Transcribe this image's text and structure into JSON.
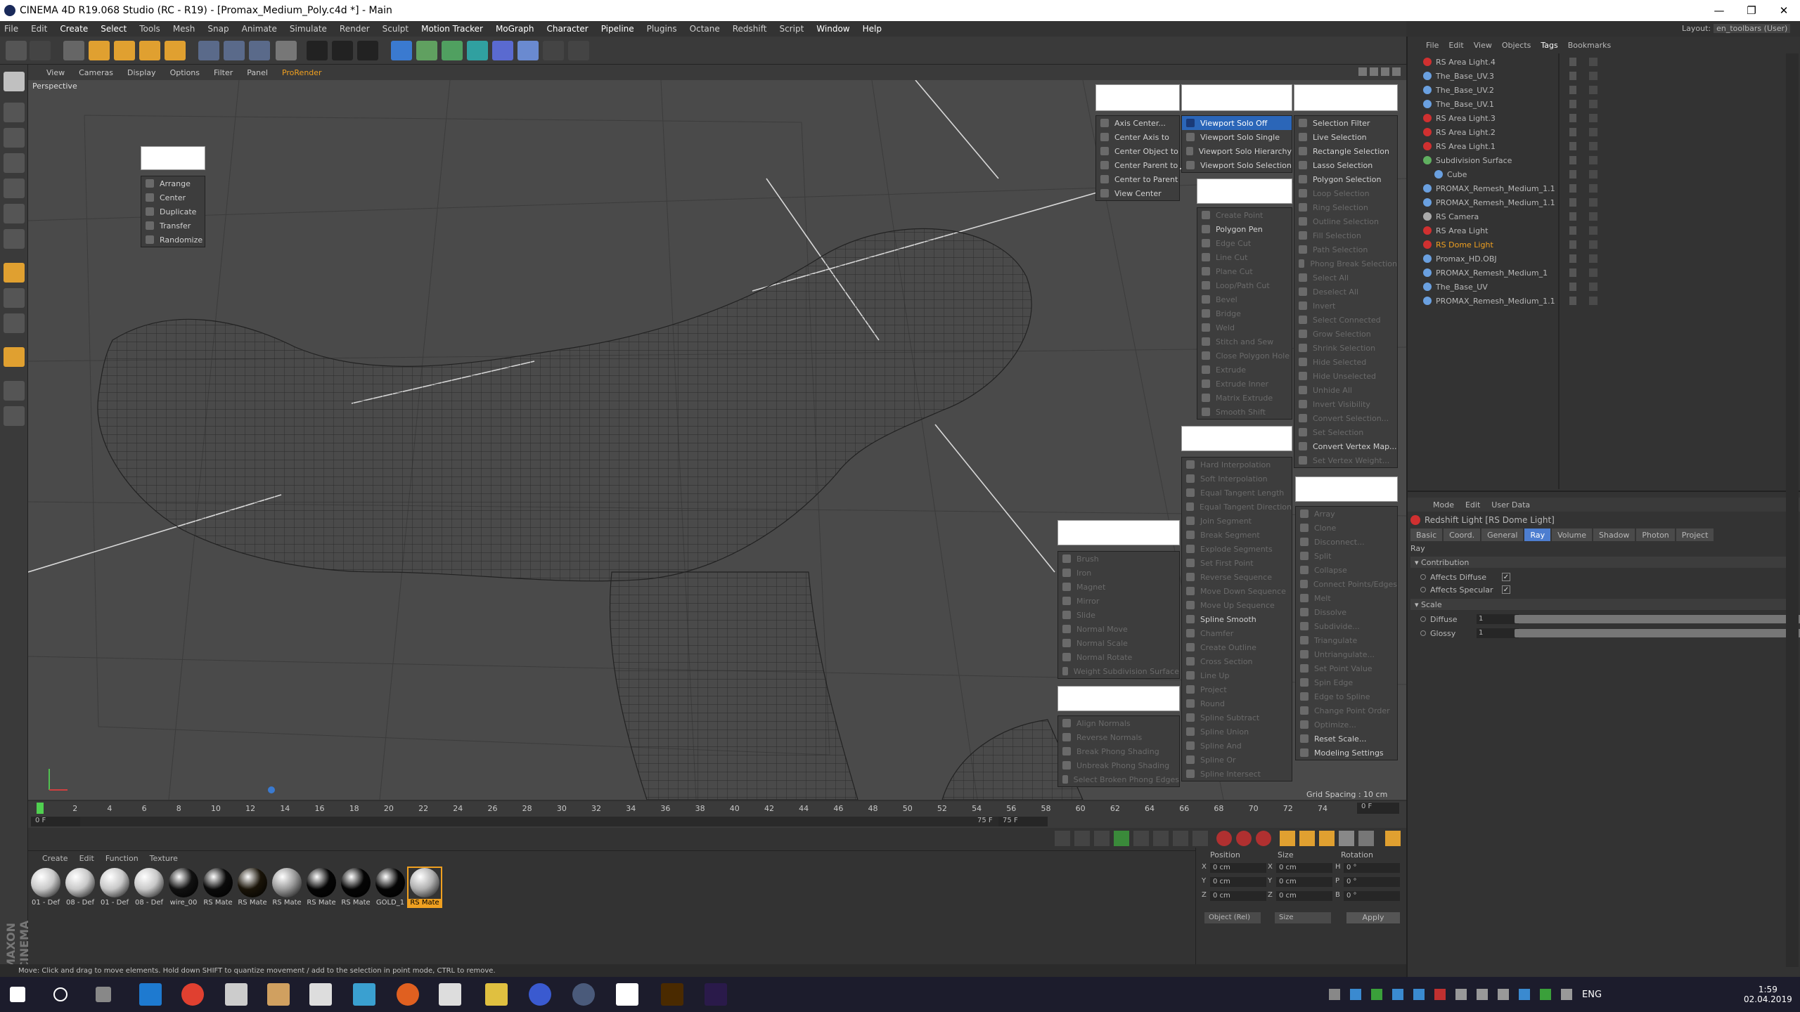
{
  "window": {
    "title": "CINEMA 4D R19.068 Studio (RC - R19) - [Promax_Medium_Poly.c4d *] - Main",
    "controls": [
      "—",
      "❐",
      "✕"
    ]
  },
  "menubar": {
    "items": [
      "File",
      "Edit",
      "Create",
      "Select",
      "Tools",
      "Mesh",
      "Snap",
      "Animate",
      "Simulate",
      "Render",
      "Sculpt",
      "Motion Tracker",
      "MoGraph",
      "Character",
      "Pipeline",
      "Plugins",
      "Octane",
      "Redshift",
      "Script",
      "Window",
      "Help"
    ]
  },
  "layout": {
    "label": "Layout:",
    "value": "en_toolbars (User)"
  },
  "viewport": {
    "menu": [
      "View",
      "Cameras",
      "Display",
      "Options",
      "Filter",
      "Panel",
      "ProRender"
    ],
    "camera": "Perspective",
    "grid_spacing": "Grid Spacing : 10 cm"
  },
  "palette_arrange": {
    "items": [
      {
        "label": "Arrange",
        "enabled": true
      },
      {
        "label": "Center",
        "enabled": true
      },
      {
        "label": "Duplicate",
        "enabled": true
      },
      {
        "label": "Transfer",
        "enabled": true
      },
      {
        "label": "Randomize",
        "enabled": true
      }
    ]
  },
  "palette_axis": {
    "items": [
      {
        "label": "Axis Center...",
        "enabled": true
      },
      {
        "label": "Center Axis to",
        "enabled": true
      },
      {
        "label": "Center Object to",
        "enabled": true
      },
      {
        "label": "Center Parent to",
        "enabled": true
      },
      {
        "label": "Center to Parent",
        "enabled": true
      },
      {
        "label": "View Center",
        "enabled": true
      }
    ]
  },
  "palette_solo": {
    "items": [
      {
        "label": "Viewport Solo Off",
        "enabled": true,
        "selected": true
      },
      {
        "label": "Viewport Solo Single",
        "enabled": true
      },
      {
        "label": "Viewport Solo Hierarchy",
        "enabled": true
      },
      {
        "label": "Viewport Solo Selection",
        "enabled": true
      }
    ]
  },
  "palette_mesh": {
    "items": [
      {
        "label": "Create Point",
        "enabled": false
      },
      {
        "label": "Polygon Pen",
        "enabled": true
      },
      {
        "label": "Edge Cut",
        "enabled": false
      },
      {
        "label": "Line Cut",
        "enabled": false
      },
      {
        "label": "Plane Cut",
        "enabled": false
      },
      {
        "label": "Loop/Path Cut",
        "enabled": false
      },
      {
        "label": "Bevel",
        "enabled": false
      },
      {
        "label": "Bridge",
        "enabled": false
      },
      {
        "label": "Weld",
        "enabled": false
      },
      {
        "label": "Stitch and Sew",
        "enabled": false
      },
      {
        "label": "Close Polygon Hole",
        "enabled": false
      },
      {
        "label": "Extrude",
        "enabled": false
      },
      {
        "label": "Extrude Inner",
        "enabled": false
      },
      {
        "label": "Matrix Extrude",
        "enabled": false
      },
      {
        "label": "Smooth Shift",
        "enabled": false
      }
    ]
  },
  "palette_selection": {
    "items": [
      {
        "label": "Selection Filter",
        "enabled": true
      },
      {
        "label": "Live Selection",
        "enabled": true
      },
      {
        "label": "Rectangle Selection",
        "enabled": true
      },
      {
        "label": "Lasso Selection",
        "enabled": true
      },
      {
        "label": "Polygon Selection",
        "enabled": true
      },
      {
        "label": "Loop Selection",
        "enabled": false
      },
      {
        "label": "Ring Selection",
        "enabled": false
      },
      {
        "label": "Outline Selection",
        "enabled": false
      },
      {
        "label": "Fill Selection",
        "enabled": false
      },
      {
        "label": "Path Selection",
        "enabled": false
      },
      {
        "label": "Phong Break Selection",
        "enabled": false
      },
      {
        "label": "Select All",
        "enabled": false
      },
      {
        "label": "Deselect All",
        "enabled": false
      },
      {
        "label": "Invert",
        "enabled": false
      },
      {
        "label": "Select Connected",
        "enabled": false
      },
      {
        "label": "Grow Selection",
        "enabled": false
      },
      {
        "label": "Shrink Selection",
        "enabled": false
      },
      {
        "label": "Hide Selected",
        "enabled": false
      },
      {
        "label": "Hide Unselected",
        "enabled": false
      },
      {
        "label": "Unhide All",
        "enabled": false
      },
      {
        "label": "Invert Visibility",
        "enabled": false
      },
      {
        "label": "Convert Selection...",
        "enabled": false
      },
      {
        "label": "Set Selection",
        "enabled": false
      },
      {
        "label": "Convert Vertex Map...",
        "enabled": true
      },
      {
        "label": "Set Vertex Weight...",
        "enabled": false
      }
    ]
  },
  "palette_spline": {
    "items": [
      {
        "label": "Hard Interpolation",
        "enabled": false
      },
      {
        "label": "Soft Interpolation",
        "enabled": false
      },
      {
        "label": "Equal Tangent Length",
        "enabled": false
      },
      {
        "label": "Equal Tangent Direction",
        "enabled": false
      },
      {
        "label": "Join Segment",
        "enabled": false
      },
      {
        "label": "Break Segment",
        "enabled": false
      },
      {
        "label": "Explode Segments",
        "enabled": false
      },
      {
        "label": "Set First Point",
        "enabled": false
      },
      {
        "label": "Reverse Sequence",
        "enabled": false
      },
      {
        "label": "Move Down Sequence",
        "enabled": false
      },
      {
        "label": "Move Up Sequence",
        "enabled": false
      },
      {
        "label": "Spline Smooth",
        "enabled": true
      },
      {
        "label": "Chamfer",
        "enabled": false
      },
      {
        "label": "Create Outline",
        "enabled": false
      },
      {
        "label": "Cross Section",
        "enabled": false
      },
      {
        "label": "Line Up",
        "enabled": false
      },
      {
        "label": "Project",
        "enabled": false
      },
      {
        "label": "Round",
        "enabled": false
      },
      {
        "label": "Spline Subtract",
        "enabled": false
      },
      {
        "label": "Spline Union",
        "enabled": false
      },
      {
        "label": "Spline And",
        "enabled": false
      },
      {
        "label": "Spline Or",
        "enabled": false
      },
      {
        "label": "Spline Intersect",
        "enabled": false
      }
    ]
  },
  "palette_brush": {
    "items": [
      {
        "label": "Brush",
        "enabled": false
      },
      {
        "label": "Iron",
        "enabled": false
      },
      {
        "label": "Magnet",
        "enabled": false
      },
      {
        "label": "Mirror",
        "enabled": false
      },
      {
        "label": "Slide",
        "enabled": false
      },
      {
        "label": "Normal Move",
        "enabled": false
      },
      {
        "label": "Normal Scale",
        "enabled": false
      },
      {
        "label": "Normal Rotate",
        "enabled": false
      },
      {
        "label": "Weight Subdivision Surface",
        "enabled": false
      }
    ]
  },
  "palette_phong": {
    "items": [
      {
        "label": "Align Normals",
        "enabled": false
      },
      {
        "label": "Reverse Normals",
        "enabled": false
      },
      {
        "label": "Break Phong Shading",
        "enabled": false
      },
      {
        "label": "Unbreak Phong Shading",
        "enabled": false
      },
      {
        "label": "Select Broken Phong Edges",
        "enabled": false
      }
    ]
  },
  "palette_commands": {
    "items": [
      {
        "label": "Array",
        "enabled": false
      },
      {
        "label": "Clone",
        "enabled": false
      },
      {
        "label": "Disconnect...",
        "enabled": false
      },
      {
        "label": "Split",
        "enabled": false
      },
      {
        "label": "Collapse",
        "enabled": false
      },
      {
        "label": "Connect Points/Edges",
        "enabled": false
      },
      {
        "label": "Melt",
        "enabled": false
      },
      {
        "label": "Dissolve",
        "enabled": false
      },
      {
        "label": "Subdivide...",
        "enabled": false
      },
      {
        "label": "Triangulate",
        "enabled": false
      },
      {
        "label": "Untriangulate...",
        "enabled": false
      },
      {
        "label": "Set Point Value",
        "enabled": false
      },
      {
        "label": "Spin Edge",
        "enabled": false
      },
      {
        "label": "Edge to Spline",
        "enabled": false
      },
      {
        "label": "Change Point Order",
        "enabled": false
      },
      {
        "label": "Optimize...",
        "enabled": false
      },
      {
        "label": "Reset Scale...",
        "enabled": true
      },
      {
        "label": "Modeling Settings",
        "enabled": true
      }
    ]
  },
  "timeline": {
    "ticks": [
      "0",
      "2",
      "4",
      "6",
      "8",
      "10",
      "12",
      "14",
      "16",
      "18",
      "20",
      "22",
      "24",
      "26",
      "28",
      "30",
      "32",
      "34",
      "36",
      "38",
      "40",
      "42",
      "44",
      "46",
      "48",
      "50",
      "52",
      "54",
      "56",
      "58",
      "60",
      "62",
      "64",
      "66",
      "68",
      "70",
      "72",
      "74"
    ],
    "current_frame": "0 F",
    "start_frame": "0 F",
    "end_frame": "75 F",
    "end_frame_2": "75 F",
    "cur_readout": "0 F"
  },
  "material_manager": {
    "menu": [
      "Create",
      "Edit",
      "Function",
      "Texture"
    ],
    "materials": [
      {
        "label": "01 - Def",
        "color": "#c8c8c8"
      },
      {
        "label": "08 - Def",
        "color": "#c8c8c8"
      },
      {
        "label": "01 - Def",
        "color": "#c8c8c8"
      },
      {
        "label": "08 - Def",
        "color": "#c8c8c8"
      },
      {
        "label": "wire_00",
        "color": "#111111"
      },
      {
        "label": "RS Mate",
        "color": "#0a0a0a"
      },
      {
        "label": "RS Mate",
        "color": "#1a1408"
      },
      {
        "label": "RS Mate",
        "color": "#9a9a9a"
      },
      {
        "label": "RS Mate",
        "color": "#050505"
      },
      {
        "label": "RS Mate",
        "color": "#050505"
      },
      {
        "label": "GOLD_1",
        "color": "#050505"
      },
      {
        "label": "RS Mate",
        "color": "#b0b0b0"
      }
    ]
  },
  "coordinates": {
    "headers": [
      "Position",
      "Size",
      "Rotation"
    ],
    "rows": [
      {
        "axis": "X",
        "pos": "0 cm",
        "size_axis": "X",
        "size": "0 cm",
        "rot_axis": "H",
        "rot": "0 °"
      },
      {
        "axis": "Y",
        "pos": "0 cm",
        "size_axis": "Y",
        "size": "0 cm",
        "rot_axis": "P",
        "rot": "0 °"
      },
      {
        "axis": "Z",
        "pos": "0 cm",
        "size_axis": "Z",
        "size": "0 cm",
        "rot_axis": "B",
        "rot": "0 °"
      }
    ],
    "mode": "Object (Rel)",
    "size_mode": "Size",
    "apply": "Apply"
  },
  "statusbar": {
    "text": "Move: Click and drag to move elements. Hold down SHIFT to quantize movement / add to the selection in point mode, CTRL to remove."
  },
  "object_manager": {
    "menu": [
      "File",
      "Edit",
      "View",
      "Objects",
      "Tags",
      "Bookmarks"
    ],
    "objects": [
      {
        "name": "RS Area Light.4",
        "icon": "light-icon",
        "color": "#d03030",
        "indent": 0
      },
      {
        "name": "The_Base_UV.3",
        "icon": "mesh-icon",
        "color": "#6aa0e0",
        "indent": 0
      },
      {
        "name": "The_Base_UV.2",
        "icon": "mesh-icon",
        "color": "#6aa0e0",
        "indent": 0
      },
      {
        "name": "The_Base_UV.1",
        "icon": "mesh-icon",
        "color": "#6aa0e0",
        "indent": 0
      },
      {
        "name": "RS Area Light.3",
        "icon": "light-icon",
        "color": "#d03030",
        "indent": 0
      },
      {
        "name": "RS Area Light.2",
        "icon": "light-icon",
        "color": "#d03030",
        "indent": 0
      },
      {
        "name": "RS Area Light.1",
        "icon": "light-icon",
        "color": "#d03030",
        "indent": 0
      },
      {
        "name": "Subdivision Surface",
        "icon": "subdiv-icon",
        "color": "#60b060",
        "indent": 0
      },
      {
        "name": "Cube",
        "icon": "mesh-icon",
        "color": "#6aa0e0",
        "indent": 1
      },
      {
        "name": "PROMAX_Remesh_Medium_1.1",
        "icon": "mesh-icon",
        "color": "#6aa0e0",
        "indent": 0
      },
      {
        "name": "PROMAX_Remesh_Medium_1.1",
        "icon": "mesh-icon",
        "color": "#6aa0e0",
        "indent": 0
      },
      {
        "name": "RS Camera",
        "icon": "camera-icon",
        "color": "#aaaaaa",
        "indent": 0
      },
      {
        "name": "RS Area Light",
        "icon": "light-icon",
        "color": "#d03030",
        "indent": 0
      },
      {
        "name": "RS Dome Light",
        "icon": "light-icon",
        "color": "#d03030",
        "indent": 0,
        "selected": true
      },
      {
        "name": "Promax_HD.OBJ",
        "icon": "mesh-icon",
        "color": "#6aa0e0",
        "indent": 0
      },
      {
        "name": "PROMAX_Remesh_Medium_1",
        "icon": "mesh-icon",
        "color": "#6aa0e0",
        "indent": 0
      },
      {
        "name": "The_Base_UV",
        "icon": "mesh-icon",
        "color": "#6aa0e0",
        "indent": 0
      },
      {
        "name": "PROMAX_Remesh_Medium_1.1",
        "icon": "mesh-icon",
        "color": "#6aa0e0",
        "indent": 0
      }
    ]
  },
  "attributes": {
    "menu": [
      "Mode",
      "Edit",
      "User Data"
    ],
    "title": "Redshift Light [RS Dome Light]",
    "tabs": [
      "Basic",
      "Coord.",
      "General",
      "Ray",
      "Volume",
      "Shadow",
      "Photon",
      "Project"
    ],
    "active_tab": "Ray",
    "section": "Ray",
    "contribution": {
      "label": "Contribution",
      "affects_diffuse": "Affects Diffuse",
      "affects_specular": "Affects Specular",
      "check": "✓"
    },
    "scale": {
      "label": "Scale",
      "diffuse_label": "Diffuse",
      "diffuse_value": "1",
      "glossy_label": "Glossy",
      "glossy_value": "1"
    }
  },
  "taskbar": {
    "lang": "ENG",
    "time": "1:59",
    "date": "02.04.2019"
  },
  "colors": {
    "accent_blue": "#2b66b8",
    "orange": "#f0a020",
    "tab_active": "#4d7ed0"
  }
}
